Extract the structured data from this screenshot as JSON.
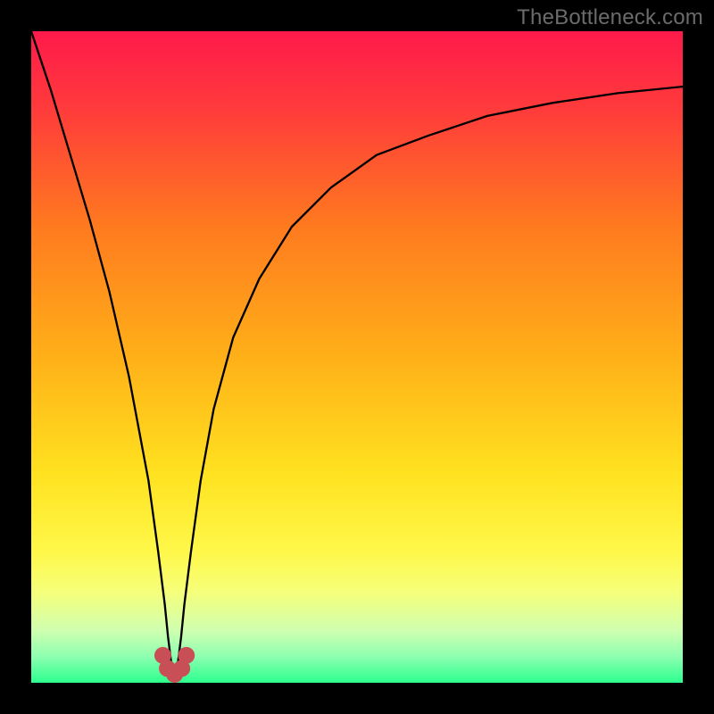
{
  "watermark": "TheBottleneck.com",
  "chart_data": {
    "type": "line",
    "title": "",
    "xlabel": "",
    "ylabel": "",
    "xlim": [
      0,
      100
    ],
    "ylim": [
      0,
      100
    ],
    "min_x": 22,
    "green_band_y": 2,
    "gradient_stops": [
      {
        "pct": 0,
        "color": "#ff1a4b"
      },
      {
        "pct": 12,
        "color": "#ff3b3b"
      },
      {
        "pct": 30,
        "color": "#ff7a1f"
      },
      {
        "pct": 50,
        "color": "#ffb018"
      },
      {
        "pct": 68,
        "color": "#ffe220"
      },
      {
        "pct": 80,
        "color": "#fff84a"
      },
      {
        "pct": 86,
        "color": "#f6ff7a"
      },
      {
        "pct": 92,
        "color": "#cfffb0"
      },
      {
        "pct": 96,
        "color": "#8dffb0"
      },
      {
        "pct": 100,
        "color": "#2bff8e"
      }
    ],
    "series": [
      {
        "name": "bottleneck-curve",
        "x": [
          0,
          3,
          6,
          9,
          12,
          15,
          18,
          19.5,
          20.5,
          21,
          21.5,
          22,
          22.5,
          23,
          23.5,
          24.5,
          26,
          28,
          31,
          35,
          40,
          46,
          53,
          61,
          70,
          80,
          90,
          100
        ],
        "values": [
          100,
          91,
          81,
          71,
          60,
          47,
          31,
          20,
          12,
          7,
          3,
          1.2,
          3,
          7,
          12,
          20,
          31,
          42,
          53,
          62,
          70,
          76,
          81,
          84,
          87,
          89,
          90.5,
          91.5
        ]
      }
    ],
    "markers": [
      {
        "x": 20.2,
        "y": 4.2
      },
      {
        "x": 20.9,
        "y": 2.2
      },
      {
        "x": 22.0,
        "y": 1.3
      },
      {
        "x": 23.1,
        "y": 2.2
      },
      {
        "x": 23.8,
        "y": 4.2
      }
    ],
    "marker_style": {
      "fill": "#c94f57",
      "r": 1.3
    }
  }
}
